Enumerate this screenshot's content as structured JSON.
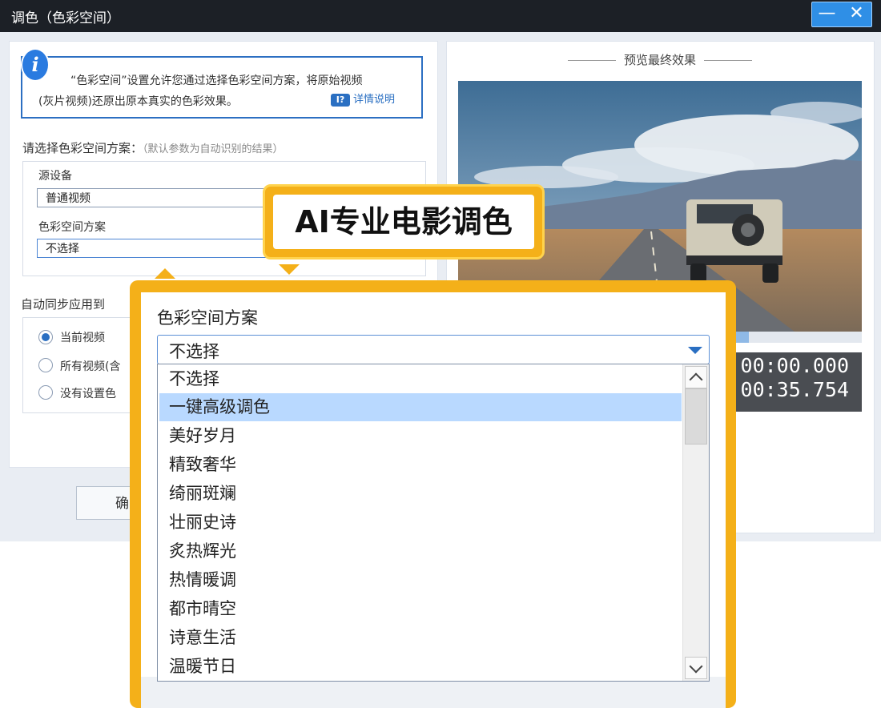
{
  "window": {
    "title": "调色（色彩空间）",
    "minimize_glyph": "—",
    "close_glyph": "✕"
  },
  "info": {
    "icon": "info-icon",
    "line1": "“色彩空间”设置允许您通过选择色彩空间方案，将原始视频",
    "line2": "(灰片视频)还原出原本真实的色彩效果。",
    "help_link": "详情说明",
    "help_icon_text": "I?"
  },
  "scheme_section": {
    "label": "请选择色彩空间方案：",
    "hint": "（默认参数为自动识别的结果）",
    "source_device_label": "源设备",
    "source_device_value": "普通视频",
    "color_space_label": "色彩空间方案",
    "color_space_value": "不选择"
  },
  "sync_section": {
    "label": "自动同步应用到",
    "options": [
      {
        "label": "当前视频",
        "checked": true
      },
      {
        "label": "所有视频(含",
        "checked": false
      },
      {
        "label": "没有设置色",
        "checked": false
      }
    ],
    "partial_text": "自",
    "confirm_label": "确"
  },
  "preview": {
    "title": "预览最终效果",
    "progress": 0.72,
    "time_current": "00:00:00.000",
    "time_total": "00:00:35.754"
  },
  "callout": {
    "text": "AI专业电影调色",
    "color": "#f4b019"
  },
  "popup": {
    "title": "色彩空间方案",
    "selected_value": "不选择",
    "options": [
      {
        "label": "不选择",
        "highlighted": false
      },
      {
        "label": "一键高级调色",
        "highlighted": true
      },
      {
        "label": "美好岁月",
        "highlighted": false
      },
      {
        "label": "精致奢华",
        "highlighted": false
      },
      {
        "label": "绮丽斑斓",
        "highlighted": false
      },
      {
        "label": "壮丽史诗",
        "highlighted": false
      },
      {
        "label": "炙热辉光",
        "highlighted": false
      },
      {
        "label": "热情暖调",
        "highlighted": false
      },
      {
        "label": "都市晴空",
        "highlighted": false
      },
      {
        "label": "诗意生活",
        "highlighted": false
      },
      {
        "label": "温暖节日",
        "highlighted": false
      }
    ]
  }
}
